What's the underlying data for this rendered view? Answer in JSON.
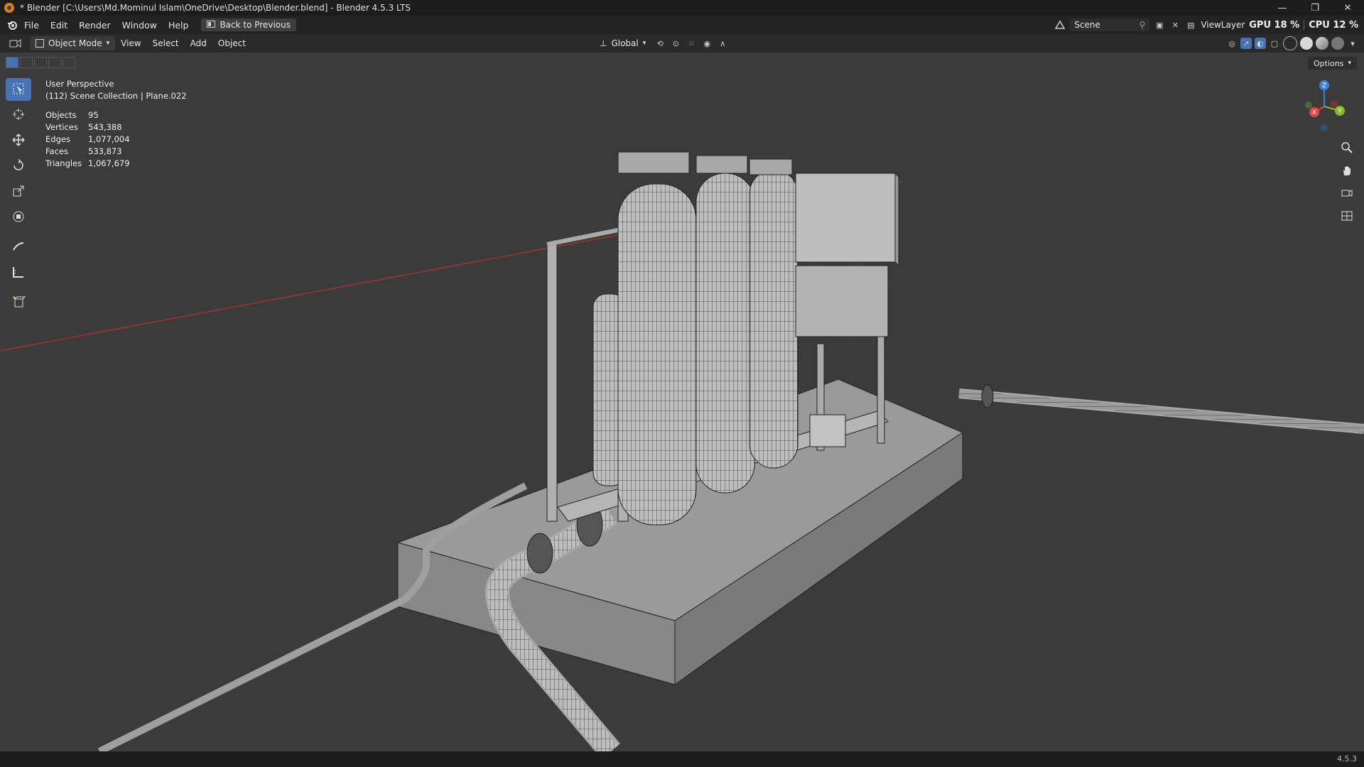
{
  "window": {
    "title": "* Blender [C:\\Users\\Md.Mominul Islam\\OneDrive\\Desktop\\Blender.blend] - Blender 4.5.3 LTS",
    "minimize": "—",
    "maximize": "❐",
    "close": "✕"
  },
  "menubar": {
    "items": [
      "File",
      "Edit",
      "Render",
      "Window",
      "Help"
    ],
    "back_button": "Back to Previous",
    "scene": "Scene",
    "view_layer": "ViewLayer",
    "gpu": "GPU 18 %",
    "cpu": "CPU 12 %"
  },
  "viewport_header": {
    "mode": "Object Mode",
    "menus": [
      "View",
      "Select",
      "Add",
      "Object"
    ],
    "orientation": "Global"
  },
  "toolbar_options": "Options",
  "overlay": {
    "view_name": "User Perspective",
    "collection": "(112) Scene Collection | Plane.022",
    "stats": [
      {
        "label": "Objects",
        "value": "95"
      },
      {
        "label": "Vertices",
        "value": "543,388"
      },
      {
        "label": "Edges",
        "value": "1,077,004"
      },
      {
        "label": "Faces",
        "value": "533,873"
      },
      {
        "label": "Triangles",
        "value": "1,067,679"
      }
    ]
  },
  "gizmo_axes": {
    "x": "X",
    "y": "Y",
    "z": "Z"
  },
  "colors": {
    "accent": "#4772b3",
    "x_axis": "#e04848",
    "y_axis": "#8bb82b",
    "z_axis": "#3c82d8"
  },
  "statusbar": {
    "version": "4.5.3"
  }
}
